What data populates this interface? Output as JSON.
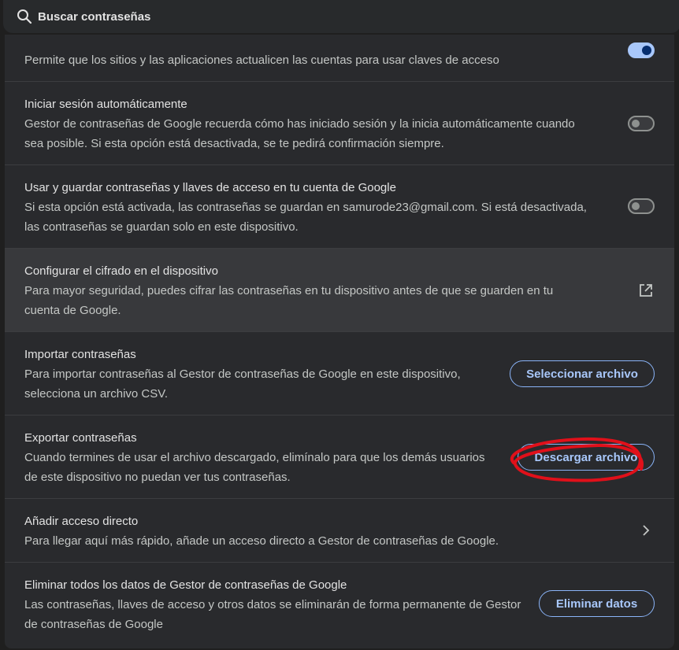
{
  "search": {
    "placeholder": "Buscar contraseñas",
    "icon": "search-icon"
  },
  "settings": {
    "passkey_update": {
      "desc": "Permite que los sitios y las aplicaciones actualicen las cuentas para usar claves de acceso",
      "enabled": true
    },
    "auto_signin": {
      "title": "Iniciar sesión automáticamente",
      "desc": "Gestor de contraseñas de Google recuerda cómo has iniciado sesión y la inicia automáticamente cuando sea posible. Si esta opción está desactivada, se te pedirá confirmación siempre.",
      "enabled": false
    },
    "account_storage": {
      "title": "Usar y guardar contraseñas y llaves de acceso en tu cuenta de Google",
      "desc": "Si esta opción está activada, las contraseñas se guardan en samurode23@gmail.com. Si está desactivada, las contraseñas se guardan solo en este dispositivo.",
      "enabled": false
    },
    "encryption": {
      "title": "Configurar el cifrado en el dispositivo",
      "desc": "Para mayor seguridad, puedes cifrar las contraseñas en tu dispositivo antes de que se guarden en tu cuenta de Google.",
      "icon": "open-in-new-icon"
    },
    "import": {
      "title": "Importar contraseñas",
      "desc": "Para importar contraseñas al Gestor de contraseñas de Google en este dispositivo, selecciona un archivo CSV.",
      "button": "Seleccionar archivo"
    },
    "export": {
      "title": "Exportar contraseñas",
      "desc": "Cuando termines de usar el archivo descargado, elimínalo para que los demás usuarios de este dispositivo no puedan ver tus contraseñas.",
      "button": "Descargar archivo"
    },
    "shortcut": {
      "title": "Añadir acceso directo",
      "desc": "Para llegar aquí más rápido, añade un acceso directo a Gestor de contraseñas de Google.",
      "icon": "chevron-right-icon"
    },
    "delete": {
      "title": "Eliminar todos los datos de Gestor de contraseñas de Google",
      "desc": "Las contraseñas, llaves de acceso y otros datos se eliminarán de forma permanente de Gestor de contraseñas de Google",
      "button": "Eliminar datos"
    }
  },
  "colors": {
    "accent": "#a8c7fa",
    "annotation": "#e0101a"
  }
}
